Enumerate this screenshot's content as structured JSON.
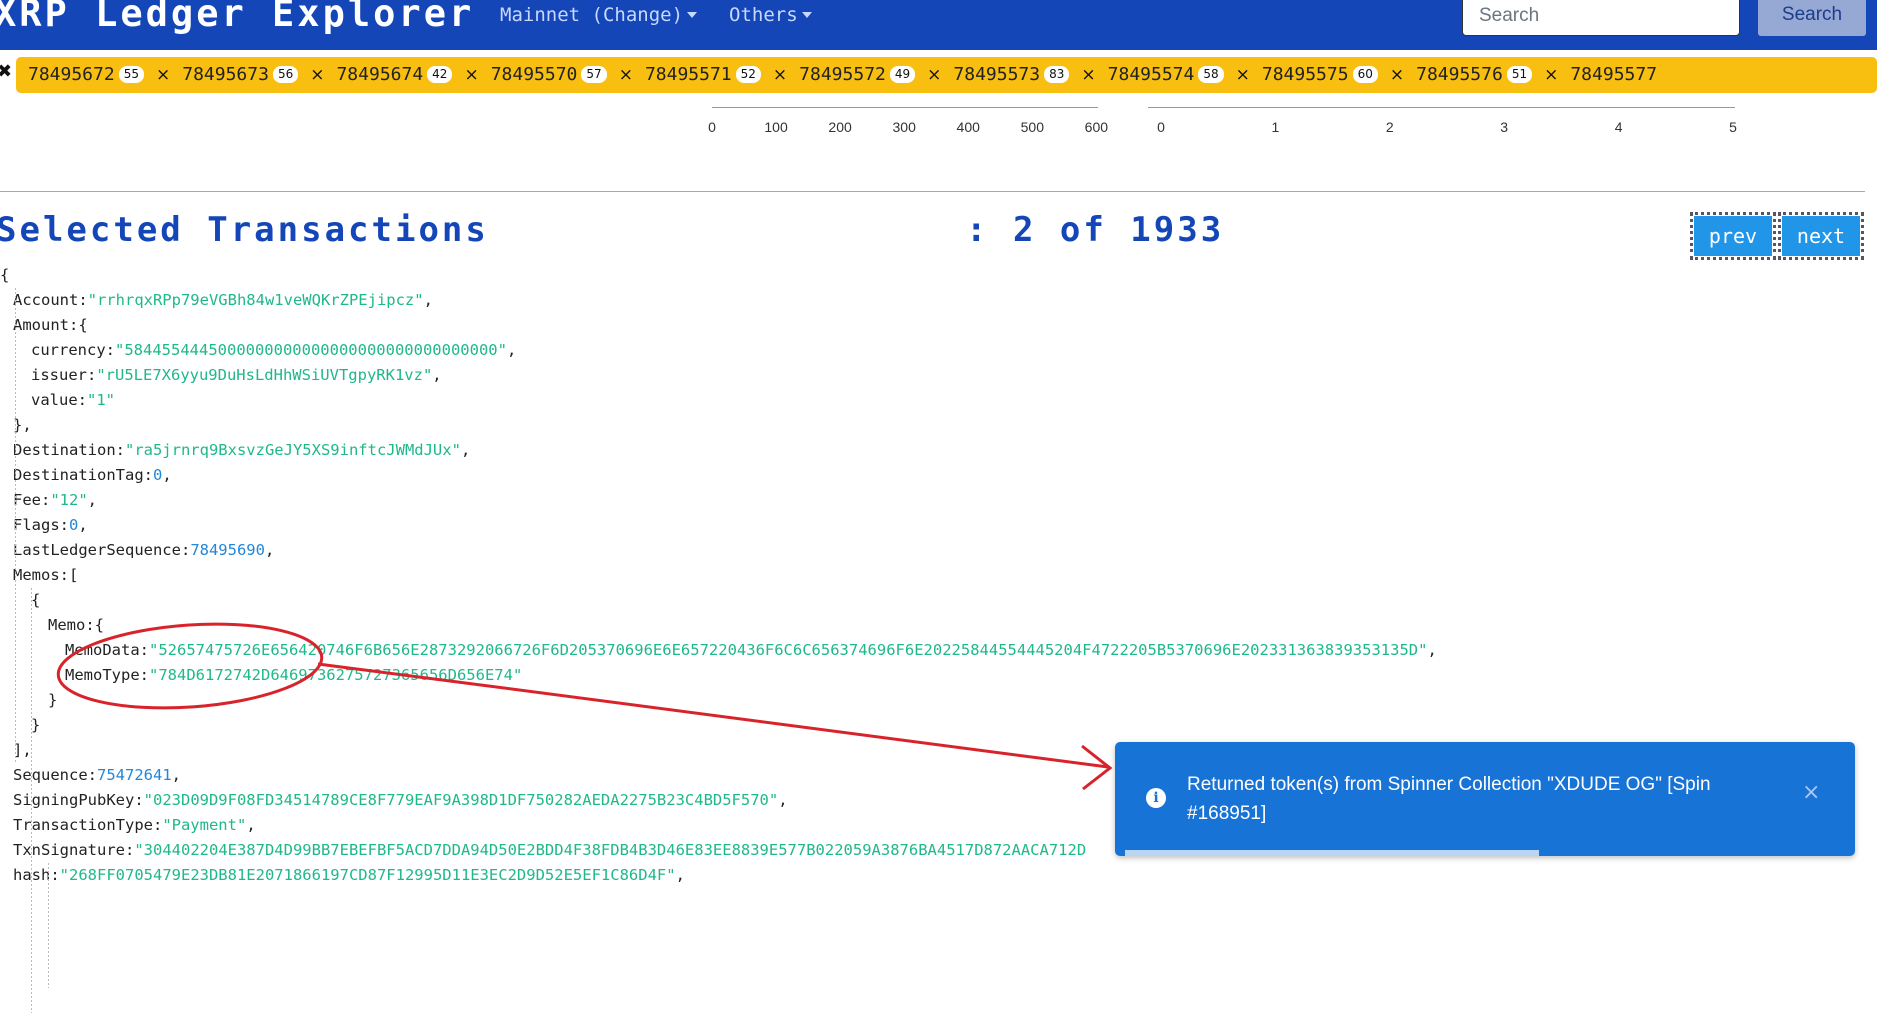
{
  "header": {
    "brand": "XRP Ledger Explorer",
    "nav_mainnet": "Mainnet (Change)",
    "nav_others": "Others",
    "search_placeholder": "Search",
    "search_button": "Search",
    "bg_color": "#1446b8"
  },
  "ticker": {
    "bg_color": "#f8be10",
    "items": [
      {
        "ledger": "78495672",
        "count": "55"
      },
      {
        "ledger": "78495673",
        "count": "56"
      },
      {
        "ledger": "78495674",
        "count": "42"
      },
      {
        "ledger": "78495570",
        "count": "57"
      },
      {
        "ledger": "78495571",
        "count": "52"
      },
      {
        "ledger": "78495572",
        "count": "49"
      },
      {
        "ledger": "78495573",
        "count": "83"
      },
      {
        "ledger": "78495574",
        "count": "58"
      },
      {
        "ledger": "78495575",
        "count": "60"
      },
      {
        "ledger": "78495576",
        "count": "51"
      },
      {
        "ledger": "78495577",
        "count": ""
      }
    ],
    "close_symbol": "×"
  },
  "scales": {
    "left_ticks": [
      "0",
      "100",
      "200",
      "300",
      "400",
      "500",
      "600"
    ],
    "right_ticks": [
      "0",
      "1",
      "2",
      "3",
      "4",
      "5"
    ]
  },
  "selection": {
    "title": "Selected Transactions",
    "count": ": 2 of 1933",
    "prev": "prev",
    "next": "next"
  },
  "tx_json": {
    "lines": [
      {
        "indent": 0,
        "key": "",
        "value": "{",
        "type": "punct",
        "trail": ""
      },
      {
        "indent": 1,
        "key": "Account:",
        "value": "\"rrhrqxRPp79eVGBh84w1veWQKrZPEjipcz\"",
        "type": "s",
        "trail": ","
      },
      {
        "indent": 1,
        "key": "Amount:",
        "value": "{",
        "type": "punct",
        "trail": ""
      },
      {
        "indent": 2,
        "key": "currency:",
        "value": "\"5844554445000000000000000000000000000000\"",
        "type": "s",
        "trail": ","
      },
      {
        "indent": 2,
        "key": "issuer:",
        "value": "\"rU5LE7X6yyu9DuHsLdHhWSiUVTgpyRK1vz\"",
        "type": "s",
        "trail": ","
      },
      {
        "indent": 2,
        "key": "value:",
        "value": "\"1\"",
        "type": "s",
        "trail": ""
      },
      {
        "indent": 1,
        "key": "",
        "value": "},",
        "type": "punct",
        "trail": ""
      },
      {
        "indent": 1,
        "key": "Destination:",
        "value": "\"ra5jrnrq9BxsvzGeJY5XS9inftcJWMdJUx\"",
        "type": "s",
        "trail": ","
      },
      {
        "indent": 1,
        "key": "DestinationTag:",
        "value": "0",
        "type": "n",
        "trail": ","
      },
      {
        "indent": 1,
        "key": "Fee:",
        "value": "\"12\"",
        "type": "s",
        "trail": ","
      },
      {
        "indent": 1,
        "key": "Flags:",
        "value": "0",
        "type": "n",
        "trail": ","
      },
      {
        "indent": 1,
        "key": "LastLedgerSequence:",
        "value": "78495690",
        "type": "n",
        "trail": ","
      },
      {
        "indent": 1,
        "key": "Memos:",
        "value": "[",
        "type": "punct",
        "trail": ""
      },
      {
        "indent": 2,
        "key": "",
        "value": "{",
        "type": "punct",
        "trail": ""
      },
      {
        "indent": 3,
        "key": "Memo:",
        "value": "{",
        "type": "punct",
        "trail": ""
      },
      {
        "indent": 4,
        "key": "MemoData:",
        "value": "\"52657475726E656420746F6B656E2873292066726F6D205370696E6E657220436F6C6C656374696F6E20225844554445204F4722205B5370696E202331363839353135D\"",
        "type": "s",
        "trail": ","
      },
      {
        "indent": 4,
        "key": "MemoType:",
        "value": "\"784D6172742D6469736275727365656D656E74\"",
        "type": "s",
        "trail": ""
      },
      {
        "indent": 3,
        "key": "",
        "value": "}",
        "type": "punct",
        "trail": ""
      },
      {
        "indent": 2,
        "key": "",
        "value": "}",
        "type": "punct",
        "trail": ""
      },
      {
        "indent": 1,
        "key": "",
        "value": "],",
        "type": "punct",
        "trail": ""
      },
      {
        "indent": 1,
        "key": "Sequence:",
        "value": "75472641",
        "type": "n",
        "trail": ","
      },
      {
        "indent": 1,
        "key": "SigningPubKey:",
        "value": "\"023D09D9F08FD34514789CE8F779EAF9A398D1DF750282AEDA2275B23C4BD5F570\"",
        "type": "s",
        "trail": ","
      },
      {
        "indent": 1,
        "key": "TransactionType:",
        "value": "\"Payment\"",
        "type": "s",
        "trail": ","
      },
      {
        "indent": 1,
        "key": "TxnSignature:",
        "value": "\"304402204E387D4D99BB7EBEFBF5ACD7DDA94D50E2BDD4F38FDB4B3D46E83EE8839E577B022059A3876BA4517D872AACA712D",
        "type": "s",
        "trail": ""
      },
      {
        "indent": 1,
        "key": "hash:",
        "value": "\"268FF0705479E23DB81E2071866197CD87F12995D11E3EC2D9D52E5EF1C86D4F\"",
        "type": "s",
        "trail": ","
      }
    ]
  },
  "toast": {
    "message": "Returned token(s) from Spinner Collection \"XDUDE OG\" [Spin #168951]",
    "close": "×",
    "icon": "info-icon",
    "bg_color": "#1873d6"
  },
  "annotation": {
    "color": "#d9232a"
  }
}
